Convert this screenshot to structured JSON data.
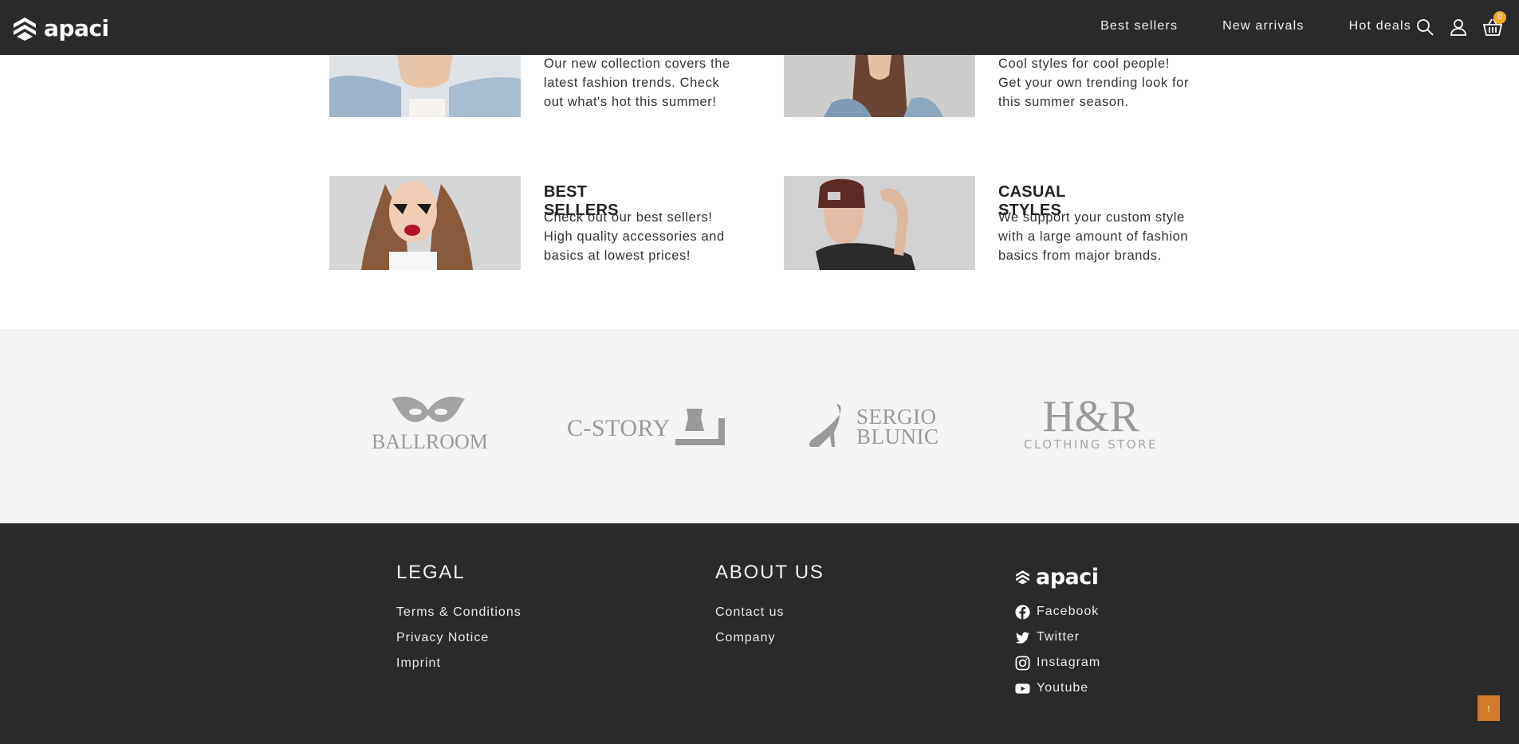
{
  "header": {
    "logo_text": "apaci",
    "nav": [
      "Best sellers",
      "New arrivals",
      "Hot deals"
    ],
    "cart_count": "0",
    "icons": [
      "search-icon",
      "user-icon",
      "basket-icon"
    ]
  },
  "features": [
    {
      "title": "",
      "text": "Our new collection covers the latest fashion trends. Check out what's hot this summer!",
      "image": "woman-denim-jacket-photo"
    },
    {
      "title": "",
      "text": "Cool styles for cool people! Get your own trending look for this summer season.",
      "image": "woman-brown-hair-photo"
    },
    {
      "title": "BEST SELLERS",
      "text": "Check out our best sellers! High quality accessories and basics at lowest prices!",
      "image": "woman-heart-sunglasses-photo"
    },
    {
      "title": "CASUAL STYLES",
      "text": "We support your custom style with a large amount of fashion basics from major brands.",
      "image": "woman-beanie-photo"
    }
  ],
  "brands": [
    {
      "name": "BALLROOM"
    },
    {
      "name": "C-STORY"
    },
    {
      "name": "SERGIO BLUNIC"
    },
    {
      "name": "H&R",
      "tagline": "CLOTHING STORE"
    }
  ],
  "footer": {
    "legal": {
      "heading": "LEGAL",
      "links": [
        "Terms & Conditions",
        "Privacy Notice",
        "Imprint"
      ]
    },
    "about": {
      "heading": "ABOUT US",
      "links": [
        "Contact us",
        "Company"
      ]
    },
    "logo_text": "apaci",
    "social": [
      {
        "label": "Facebook",
        "icon": "facebook-icon"
      },
      {
        "label": "Twitter",
        "icon": "twitter-icon"
      },
      {
        "label": "Instagram",
        "icon": "instagram-icon"
      },
      {
        "label": "Youtube",
        "icon": "youtube-icon"
      }
    ],
    "to_top": "↑"
  },
  "colors": {
    "header_bg": "#2a2a2a",
    "brands_bg": "#f4f4f4",
    "accent": "#f5a623",
    "to_top_bg": "#d07a2a"
  }
}
